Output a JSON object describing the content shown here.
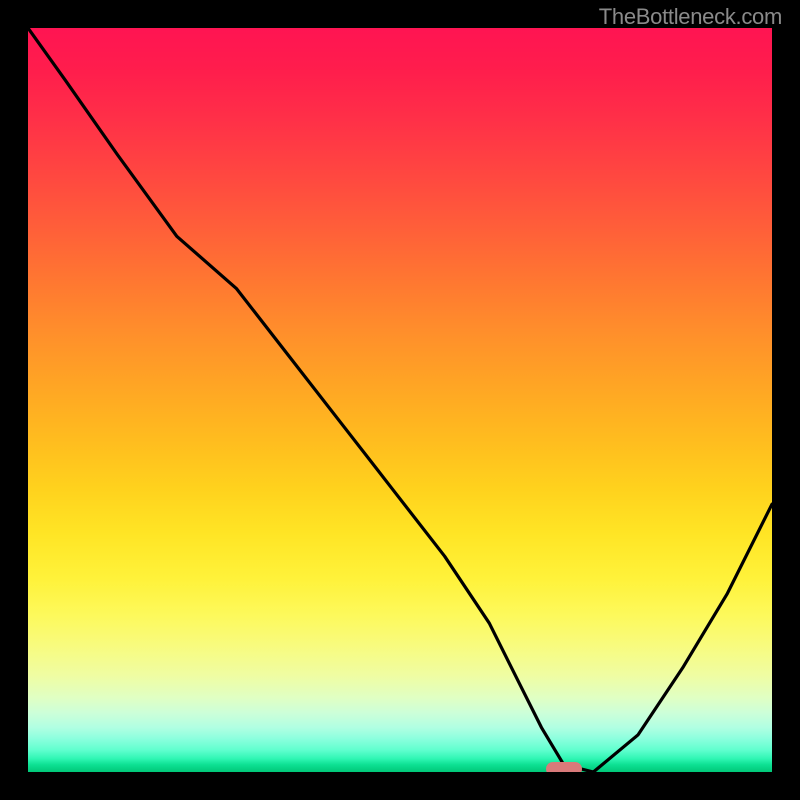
{
  "watermark": "TheBottleneck.com",
  "chart_data": {
    "type": "line",
    "title": "",
    "xlabel": "",
    "ylabel": "",
    "xlim": [
      0,
      100
    ],
    "ylim": [
      0,
      100
    ],
    "grid": false,
    "background_gradient": {
      "top_color": "#ff1452",
      "bottom_color": "#00c878",
      "description": "vertical red-to-green gradient representing bottleneck severity"
    },
    "series": [
      {
        "name": "bottleneck-curve",
        "x": [
          0,
          5,
          12,
          20,
          28,
          35,
          42,
          49,
          56,
          62,
          66,
          69,
          72,
          76,
          82,
          88,
          94,
          100
        ],
        "y": [
          100,
          93,
          83,
          72,
          65,
          56,
          47,
          38,
          29,
          20,
          12,
          6,
          1,
          0,
          5,
          14,
          24,
          36
        ],
        "color": "#000000"
      }
    ],
    "marker": {
      "x": 72,
      "y": 0.4,
      "color": "#d97a7a",
      "shape": "pill"
    }
  }
}
